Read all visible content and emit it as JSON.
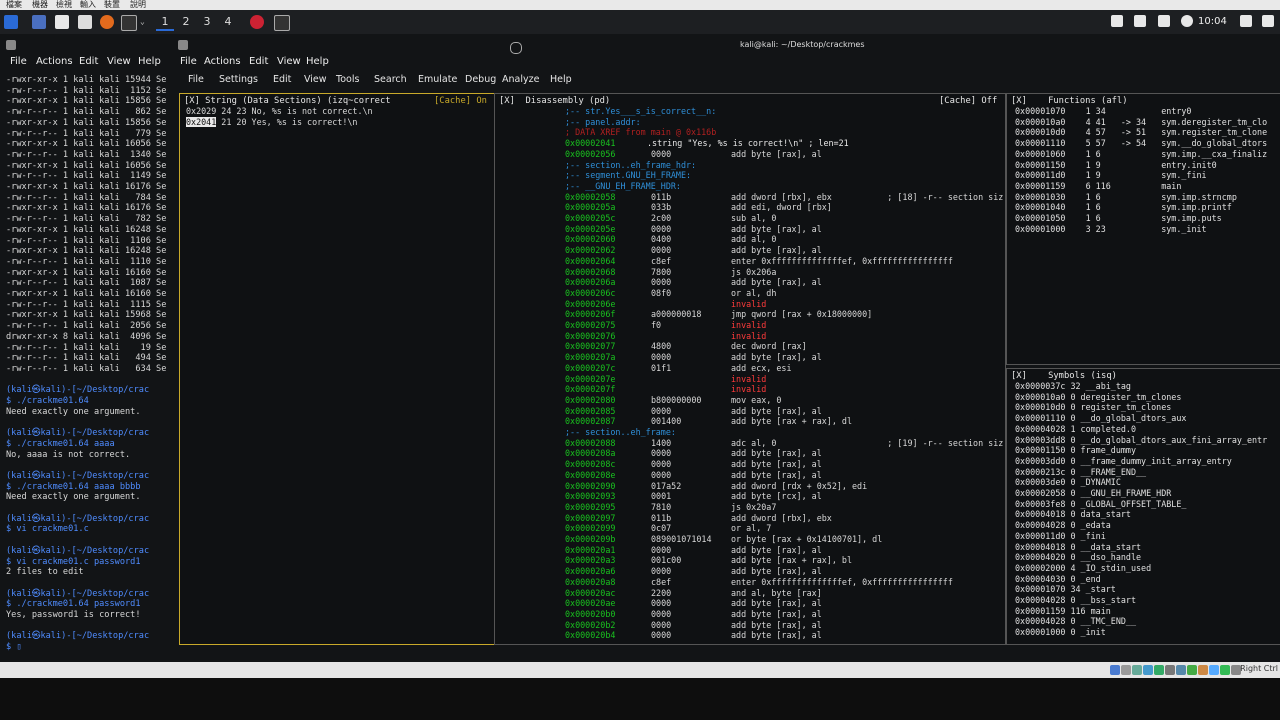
{
  "host_menu": [
    "檔案",
    "機器",
    "檢視",
    "輸入",
    "裝置",
    "說明"
  ],
  "taskbar": {
    "workspaces": [
      "1",
      "2",
      "3",
      "4"
    ],
    "clock": "10:04"
  },
  "left_terminal": {
    "menu": [
      "File",
      "Actions",
      "Edit",
      "View",
      "Help"
    ],
    "listing": [
      "-rwxr-xr-x 1 kali kali 15944 Se",
      "-rw-r--r-- 1 kali kali  1152 Se",
      "-rwxr-xr-x 1 kali kali 15856 Se",
      "-rw-r--r-- 1 kali kali   862 Se",
      "-rwxr-xr-x 1 kali kali 15856 Se",
      "-rw-r--r-- 1 kali kali   779 Se",
      "-rwxr-xr-x 1 kali kali 16056 Se",
      "-rw-r--r-- 1 kali kali  1340 Se",
      "-rwxr-xr-x 1 kali kali 16056 Se",
      "-rw-r--r-- 1 kali kali  1149 Se",
      "-rwxr-xr-x 1 kali kali 16176 Se",
      "-rw-r--r-- 1 kali kali   784 Se",
      "-rwxr-xr-x 1 kali kali 16176 Se",
      "-rw-r--r-- 1 kali kali   782 Se",
      "-rwxr-xr-x 1 kali kali 16248 Se",
      "-rw-r--r-- 1 kali kali  1106 Se",
      "-rwxr-xr-x 1 kali kali 16248 Se",
      "-rw-r--r-- 1 kali kali  1110 Se",
      "-rwxr-xr-x 1 kali kali 16160 Se",
      "-rw-r--r-- 1 kali kali  1087 Se",
      "-rwxr-xr-x 1 kali kali 16160 Se",
      "-rw-r--r-- 1 kali kali  1115 Se",
      "-rwxr-xr-x 1 kali kali 15968 Se",
      "-rw-r--r-- 1 kali kali  2056 Se",
      "drwxr-xr-x 8 kali kali  4096 Se",
      "-rw-r--r-- 1 kali kali    19 Se",
      "-rw-r--r-- 1 kali kali   494 Se",
      "-rw-r--r-- 1 kali kali   634 Se"
    ],
    "sessions": [
      {
        "prompt": "(kali㉿kali)-[~/Desktop/crac",
        "cmd": "$ ./crackme01.64",
        "out": [
          "Need exactly one argument."
        ]
      },
      {
        "prompt": "(kali㉿kali)-[~/Desktop/crac",
        "cmd": "$ ./crackme01.64 aaaa",
        "out": [
          "No, aaaa is not correct."
        ]
      },
      {
        "prompt": "(kali㉿kali)-[~/Desktop/crac",
        "cmd": "$ ./crackme01.64 aaaa bbbb",
        "out": [
          "Need exactly one argument."
        ]
      },
      {
        "prompt": "(kali㉿kali)-[~/Desktop/crac",
        "cmd": "$ vi crackme01.c",
        "out": []
      },
      {
        "prompt": "(kali㉿kali)-[~/Desktop/crac",
        "cmd": "$ vi crackme01.c password1",
        "out": [
          "2 files to edit"
        ]
      },
      {
        "prompt": "(kali㉿kali)-[~/Desktop/crac",
        "cmd": "$ ./crackme01.64 password1",
        "out": [
          "Yes, password1 is correct!"
        ]
      },
      {
        "prompt": "(kali㉿kali)-[~/Desktop/crac",
        "cmd": "$ ▯",
        "out": []
      }
    ]
  },
  "main_window": {
    "title": "kali@kali: ~/Desktop/crackmes",
    "menu": [
      "File",
      "Actions",
      "Edit",
      "View",
      "Help"
    ],
    "r2_menu": [
      "File",
      "Settings",
      "Edit",
      "View",
      "Tools",
      "Search",
      "Emulate",
      "Debug",
      "Analyze",
      "Help"
    ]
  },
  "strings_panel": {
    "title": "[X] String (Data Sections) (izq~correct",
    "cache": "[Cache] On",
    "rows": [
      {
        "addr": "0x2029",
        "rest": " 24 23 No, %s is not correct.\\n",
        "selected": false
      },
      {
        "addr": "0x2041",
        "rest": " 21 20 Yes, %s is correct!\\n",
        "selected": true
      }
    ]
  },
  "disasm_panel": {
    "title": "[X]  Disassembly (pd)",
    "cache": "[Cache] Off",
    "rows": [
      {
        "a": "",
        "b": "",
        "o": ";-- str.Yes___s_is_correct__n:",
        "k": "c"
      },
      {
        "a": "",
        "b": "",
        "o": ";-- panel.addr:",
        "k": "c"
      },
      {
        "a": "",
        "b": "",
        "o": "; DATA XREF from main @ 0x116b",
        "k": "r"
      },
      {
        "a": "0x00002041",
        "b": "",
        "o": ".string \"Yes, %s is correct!\\n\" ; len=21",
        "k": "s"
      },
      {
        "a": "0x00002056",
        "b": "0000",
        "o": "add byte [rax], al",
        "k": "n"
      },
      {
        "a": "",
        "b": "",
        "o": ";-- section..eh_frame_hdr:",
        "k": "c"
      },
      {
        "a": "",
        "b": "",
        "o": ";-- segment.GNU_EH_FRAME:",
        "k": "c"
      },
      {
        "a": "",
        "b": "",
        "o": ";-- __GNU_EH_FRAME_HDR:",
        "k": "c"
      },
      {
        "a": "0x00002058",
        "b": "011b",
        "o": "add dword [rbx], ebx           ; [18] -r-- section siz",
        "k": "n"
      },
      {
        "a": "0x0000205a",
        "b": "033b",
        "o": "add edi, dword [rbx]",
        "k": "n"
      },
      {
        "a": "0x0000205c",
        "b": "2c00",
        "o": "sub al, 0",
        "k": "n"
      },
      {
        "a": "0x0000205e",
        "b": "0000",
        "o": "add byte [rax], al",
        "k": "n"
      },
      {
        "a": "0x00002060",
        "b": "0400",
        "o": "add al, 0",
        "k": "n"
      },
      {
        "a": "0x00002062",
        "b": "0000",
        "o": "add byte [rax], al",
        "k": "n"
      },
      {
        "a": "0x00002064",
        "b": "c8ef",
        "o": "enter 0xffffffffffffffef, 0xffffffffffffffff",
        "k": "n"
      },
      {
        "a": "0x00002068",
        "b": "7800",
        "o": "js 0x206a",
        "k": "n"
      },
      {
        "a": "0x0000206a",
        "b": "0000",
        "o": "add byte [rax], al",
        "k": "n"
      },
      {
        "a": "0x0000206c",
        "b": "08f0",
        "o": "or al, dh",
        "k": "n"
      },
      {
        "a": "0x0000206e",
        "b": "",
        "o": "invalid",
        "k": "i"
      },
      {
        "a": "0x0000206f",
        "b": "a000000018",
        "o": "jmp qword [rax + 0x18000000]",
        "k": "n"
      },
      {
        "a": "0x00002075",
        "b": "f0",
        "o": "invalid",
        "k": "i"
      },
      {
        "a": "0x00002076",
        "b": "",
        "o": "invalid",
        "k": "i"
      },
      {
        "a": "0x00002077",
        "b": "4800",
        "o": "dec dword [rax]",
        "k": "n"
      },
      {
        "a": "0x0000207a",
        "b": "0000",
        "o": "add byte [rax], al",
        "k": "n"
      },
      {
        "a": "0x0000207c",
        "b": "01f1",
        "o": "add ecx, esi",
        "k": "n"
      },
      {
        "a": "0x0000207e",
        "b": "",
        "o": "invalid",
        "k": "i"
      },
      {
        "a": "0x0000207f",
        "b": "",
        "o": "invalid",
        "k": "i"
      },
      {
        "a": "0x00002080",
        "b": "b800000000",
        "o": "mov eax, 0",
        "k": "n"
      },
      {
        "a": "0x00002085",
        "b": "0000",
        "o": "add byte [rax], al",
        "k": "n"
      },
      {
        "a": "0x00002087",
        "b": "001400",
        "o": "add byte [rax + rax], dl",
        "k": "n"
      },
      {
        "a": "",
        "b": "",
        "o": ";-- section..eh_frame:",
        "k": "c"
      },
      {
        "a": "0x00002088",
        "b": "1400",
        "o": "adc al, 0                      ; [19] -r-- section siz",
        "k": "n"
      },
      {
        "a": "0x0000208a",
        "b": "0000",
        "o": "add byte [rax], al",
        "k": "n"
      },
      {
        "a": "0x0000208c",
        "b": "0000",
        "o": "add byte [rax], al",
        "k": "n"
      },
      {
        "a": "0x0000208e",
        "b": "0000",
        "o": "add byte [rax], al",
        "k": "n"
      },
      {
        "a": "0x00002090",
        "b": "017a52",
        "o": "add dword [rdx + 0x52], edi",
        "k": "n"
      },
      {
        "a": "0x00002093",
        "b": "0001",
        "o": "add byte [rcx], al",
        "k": "n"
      },
      {
        "a": "0x00002095",
        "b": "7810",
        "o": "js 0x20a7",
        "k": "n"
      },
      {
        "a": "0x00002097",
        "b": "011b",
        "o": "add dword [rbx], ebx",
        "k": "n"
      },
      {
        "a": "0x00002099",
        "b": "0c07",
        "o": "or al, 7",
        "k": "n"
      },
      {
        "a": "0x0000209b",
        "b": "089001071014",
        "o": "or byte [rax + 0x14100701], dl",
        "k": "n"
      },
      {
        "a": "0x000020a1",
        "b": "0000",
        "o": "add byte [rax], al",
        "k": "n"
      },
      {
        "a": "0x000020a3",
        "b": "001c00",
        "o": "add byte [rax + rax], bl",
        "k": "n"
      },
      {
        "a": "0x000020a6",
        "b": "0000",
        "o": "add byte [rax], al",
        "k": "n"
      },
      {
        "a": "0x000020a8",
        "b": "c8ef",
        "o": "enter 0xffffffffffffffef, 0xffffffffffffffff",
        "k": "n"
      },
      {
        "a": "0x000020ac",
        "b": "2200",
        "o": "and al, byte [rax]",
        "k": "n"
      },
      {
        "a": "0x000020ae",
        "b": "0000",
        "o": "add byte [rax], al",
        "k": "n"
      },
      {
        "a": "0x000020b0",
        "b": "0000",
        "o": "add byte [rax], al",
        "k": "n"
      },
      {
        "a": "0x000020b2",
        "b": "0000",
        "o": "add byte [rax], al",
        "k": "n"
      },
      {
        "a": "0x000020b4",
        "b": "0000",
        "o": "add byte [rax], al",
        "k": "n"
      }
    ]
  },
  "functions_panel": {
    "title": "[X]    Functions (afl)",
    "rows": [
      "0x00001070    1 34           entry0",
      "0x000010a0    4 41   -> 34   sym.deregister_tm_clo",
      "0x000010d0    4 57   -> 51   sym.register_tm_clone",
      "0x00001110    5 57   -> 54   sym.__do_global_dtors",
      "0x00001060    1 6            sym.imp.__cxa_finaliz",
      "0x00001150    1 9            entry.init0",
      "0x000011d0    1 9            sym._fini",
      "0x00001159    6 116          main",
      "0x00001030    1 6            sym.imp.strncmp",
      "0x00001040    1 6            sym.imp.printf",
      "0x00001050    1 6            sym.imp.puts",
      "0x00001000    3 23           sym._init"
    ]
  },
  "symbols_panel": {
    "title": "[X]    Symbols (isq)",
    "rows": [
      "0x0000037c 32 __abi_tag",
      "0x000010a0 0 deregister_tm_clones",
      "0x000010d0 0 register_tm_clones",
      "0x00001110 0 __do_global_dtors_aux",
      "0x00004028 1 completed.0",
      "0x00003dd8 0 __do_global_dtors_aux_fini_array_entr",
      "0x00001150 0 frame_dummy",
      "0x00003dd0 0 __frame_dummy_init_array_entry",
      "0x0000213c 0 __FRAME_END__",
      "0x00003de0 0 _DYNAMIC",
      "0x00002058 0 __GNU_EH_FRAME_HDR",
      "0x00003fe8 0 _GLOBAL_OFFSET_TABLE_",
      "0x00004018 0 data_start",
      "0x00004028 0 _edata",
      "0x000011d0 0 _fini",
      "0x00004018 0 __data_start",
      "0x00004020 0 __dso_handle",
      "0x00002000 4 _IO_stdin_used",
      "0x00004030 0 _end",
      "0x00001070 34 _start",
      "0x00004028 0 __bss_start",
      "0x00001159 116 main",
      "0x00004028 0 __TMC_END__",
      "0x00001000 0 _init"
    ]
  },
  "host_status": {
    "label": "Right Ctrl"
  },
  "colors": {
    "accent": "#c8a92a",
    "addr": "#19c21f",
    "comment": "#2f8fd8",
    "invalid": "#ff3b3b",
    "string": "#d8c23a",
    "prompt": "#4f8cff"
  }
}
